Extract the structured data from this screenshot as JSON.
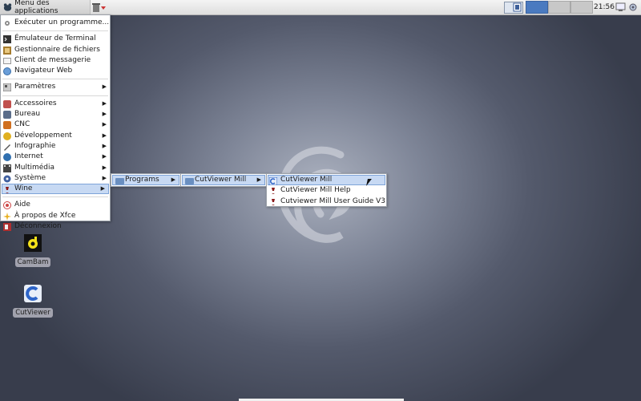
{
  "panel": {
    "app_menu_label": "Menu des applications",
    "clock": "21:56",
    "workspaces_count": 4
  },
  "desktop": {
    "icons": [
      {
        "label": "CamBam",
        "icon": "cambam-icon"
      },
      {
        "label": "CutViewer",
        "icon": "cutviewer-icon"
      }
    ]
  },
  "app_menu": {
    "run_program": "Exécuter un programme...",
    "favorites": [
      {
        "label": "Émulateur de Terminal",
        "icon": "terminal-icon"
      },
      {
        "label": "Gestionnaire de fichiers",
        "icon": "file-manager-icon"
      },
      {
        "label": "Client de messagerie",
        "icon": "mail-icon"
      },
      {
        "label": "Navigateur Web",
        "icon": "web-browser-icon"
      }
    ],
    "settings": "Paramètres",
    "categories": [
      {
        "label": "Accessoires",
        "icon": "accessories-icon",
        "color": "#c0504d"
      },
      {
        "label": "Bureau",
        "icon": "office-icon",
        "color": "#5a6d8a"
      },
      {
        "label": "CNC",
        "icon": "cnc-icon",
        "color": "#d07020"
      },
      {
        "label": "Développement",
        "icon": "development-icon",
        "color": "#e0b020"
      },
      {
        "label": "Infographie",
        "icon": "graphics-icon",
        "color": "#555555"
      },
      {
        "label": "Internet",
        "icon": "internet-icon",
        "color": "#3070b0"
      },
      {
        "label": "Multimédia",
        "icon": "multimedia-icon",
        "color": "#444444"
      },
      {
        "label": "Système",
        "icon": "system-icon",
        "color": "#4060a0"
      },
      {
        "label": "Wine",
        "icon": "wine-icon",
        "color": "#8a1a1a"
      }
    ],
    "help": "Aide",
    "about": "À propos de Xfce",
    "logout": "Déconnexion"
  },
  "submenus": {
    "wine": {
      "items": [
        "Programs"
      ]
    },
    "programs": {
      "items": [
        "CutViewer Mill"
      ]
    },
    "cutviewer": {
      "items": [
        "CutViewer Mill",
        "CutViewer Mill Help",
        "Cutviewer Mill User Guide V3"
      ]
    }
  },
  "colors": {
    "highlight": "#c7d9f3",
    "highlight_border": "#7ea4d8",
    "workspace_active": "#4a7ac0"
  }
}
